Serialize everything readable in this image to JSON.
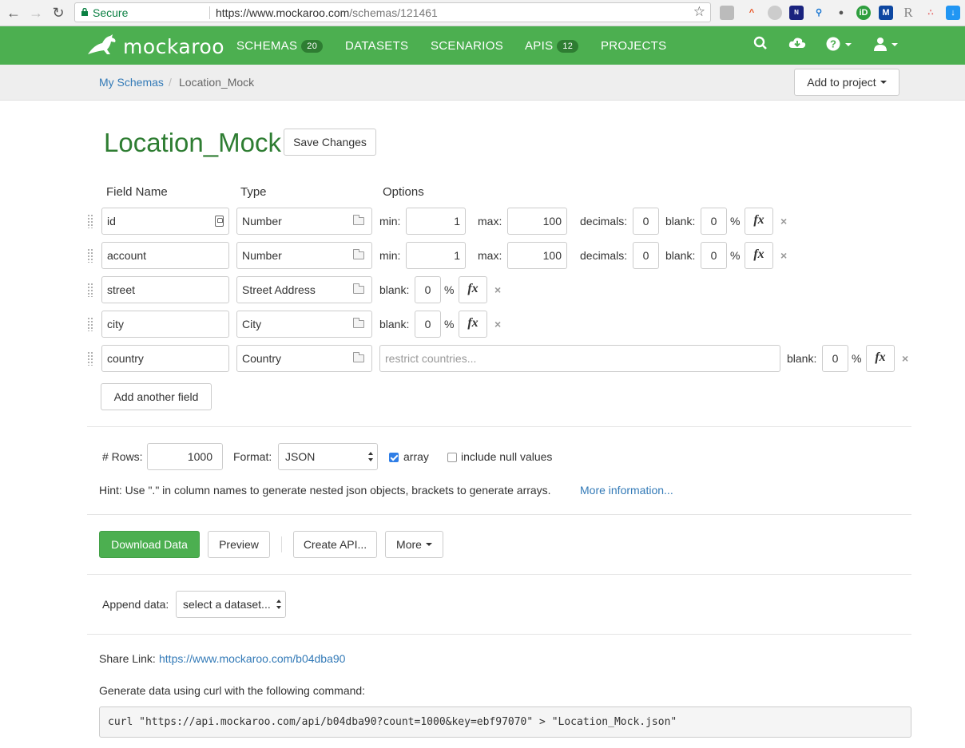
{
  "browser": {
    "secure_label": "Secure",
    "url_domain": "https://www.mockaroo.com",
    "url_path": "/schemas/121461"
  },
  "navbar": {
    "brand": "mockaroo",
    "items": [
      {
        "label": "SCHEMAS",
        "badge": "20"
      },
      {
        "label": "DATASETS"
      },
      {
        "label": "SCENARIOS"
      },
      {
        "label": "APIS",
        "badge": "12"
      },
      {
        "label": "PROJECTS"
      }
    ],
    "icons": [
      "search-icon",
      "cloud-download-icon",
      "help-icon",
      "user-icon"
    ]
  },
  "breadcrumb": {
    "link": "My Schemas",
    "separator": "/",
    "current": "Location_Mock"
  },
  "add_to_project_label": "Add to project",
  "schema": {
    "title": "Location_Mock",
    "save_label": "Save Changes"
  },
  "columns": {
    "field": "Field Name",
    "type": "Type",
    "options": "Options"
  },
  "labels": {
    "min": "min:",
    "max": "max:",
    "decimals": "decimals:",
    "blank": "blank:",
    "percent": "%",
    "fx": "fx",
    "remove": "×"
  },
  "fields": [
    {
      "name": "id",
      "type": "Number",
      "min": "1",
      "max": "100",
      "decimals": "0",
      "blank": "0"
    },
    {
      "name": "account",
      "type": "Number",
      "min": "1",
      "max": "100",
      "decimals": "0",
      "blank": "0"
    },
    {
      "name": "street",
      "type": "Street Address",
      "blank": "0"
    },
    {
      "name": "city",
      "type": "City",
      "blank": "0"
    },
    {
      "name": "country",
      "type": "Country",
      "restrict_placeholder": "restrict countries...",
      "blank": "0"
    }
  ],
  "add_field_label": "Add another field",
  "output": {
    "rows_label": "# Rows:",
    "rows_value": "1000",
    "format_label": "Format:",
    "format_value": "JSON",
    "array_label": "array",
    "array_checked": true,
    "null_label": "include null values",
    "null_checked": false,
    "hint": "Hint: Use \".\" in column names to generate nested json objects, brackets to generate arrays.",
    "more_info": "More information..."
  },
  "actions": {
    "download": "Download Data",
    "preview": "Preview",
    "create_api": "Create API...",
    "more": "More"
  },
  "append": {
    "label": "Append data:",
    "select_value": "select a dataset..."
  },
  "share": {
    "label": "Share Link:",
    "url": "https://www.mockaroo.com/b04dba90"
  },
  "curl": {
    "label": "Generate data using curl with the following command:",
    "command": "curl \"https://api.mockaroo.com/api/b04dba90?count=1000&key=ebf97070\" > \"Location_Mock.json\""
  },
  "colors": {
    "brand_green": "#4caf50",
    "title_green": "#2e7d32",
    "link_blue": "#337ab7"
  }
}
